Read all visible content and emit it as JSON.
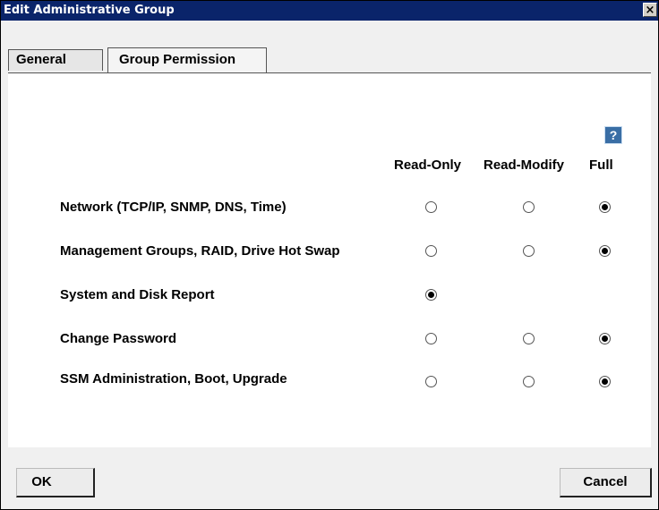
{
  "window": {
    "title": "Edit Administrative Group",
    "close_label": "×"
  },
  "tabs": [
    {
      "label": "General"
    },
    {
      "label": "Group Permission"
    }
  ],
  "help_label": "?",
  "columns": [
    "Read-Only",
    "Read-Modify",
    "Full"
  ],
  "rows": [
    {
      "label": "Network (TCP/IP, SNMP, DNS, Time)",
      "selected": "Full"
    },
    {
      "label": "Management Groups, RAID, Drive Hot Swap",
      "selected": "Full"
    },
    {
      "label": "System and Disk Report",
      "selected": "Read-Only"
    },
    {
      "label": "Change Password",
      "selected": "Full"
    },
    {
      "label": "SSM Administration, Boot, Upgrade",
      "selected": "Full"
    }
  ],
  "buttons": {
    "ok": "OK",
    "cancel": "Cancel"
  }
}
